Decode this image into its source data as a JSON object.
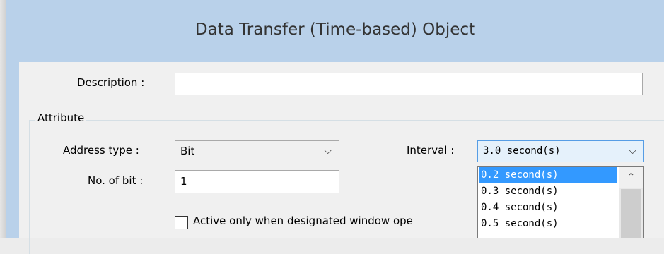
{
  "dialog": {
    "title": "Data Transfer (Time-based) Object"
  },
  "form": {
    "description_label": "Description :",
    "description_value": "",
    "group_title": "Attribute",
    "address_type_label": "Address type :",
    "address_type_value": "Bit",
    "interval_label": "Interval :",
    "interval_value": "3.0  second(s)",
    "bit_count_label": "No. of bit :",
    "bit_count_value": "1",
    "checkbox_label": "Active only when designated window ope",
    "checkbox_checked": false
  },
  "interval_options": [
    "0.2  second(s)",
    "0.3  second(s)",
    "0.4  second(s)",
    "0.5  second(s)"
  ],
  "selected_option_index": 0,
  "icons": {
    "combo_arrow": "chevron-down-icon",
    "scroll_up": "chevron-up-icon"
  },
  "colors": {
    "title_bar": "#b9d1ea",
    "selection": "#3399ff",
    "focus_border": "#569de5"
  }
}
